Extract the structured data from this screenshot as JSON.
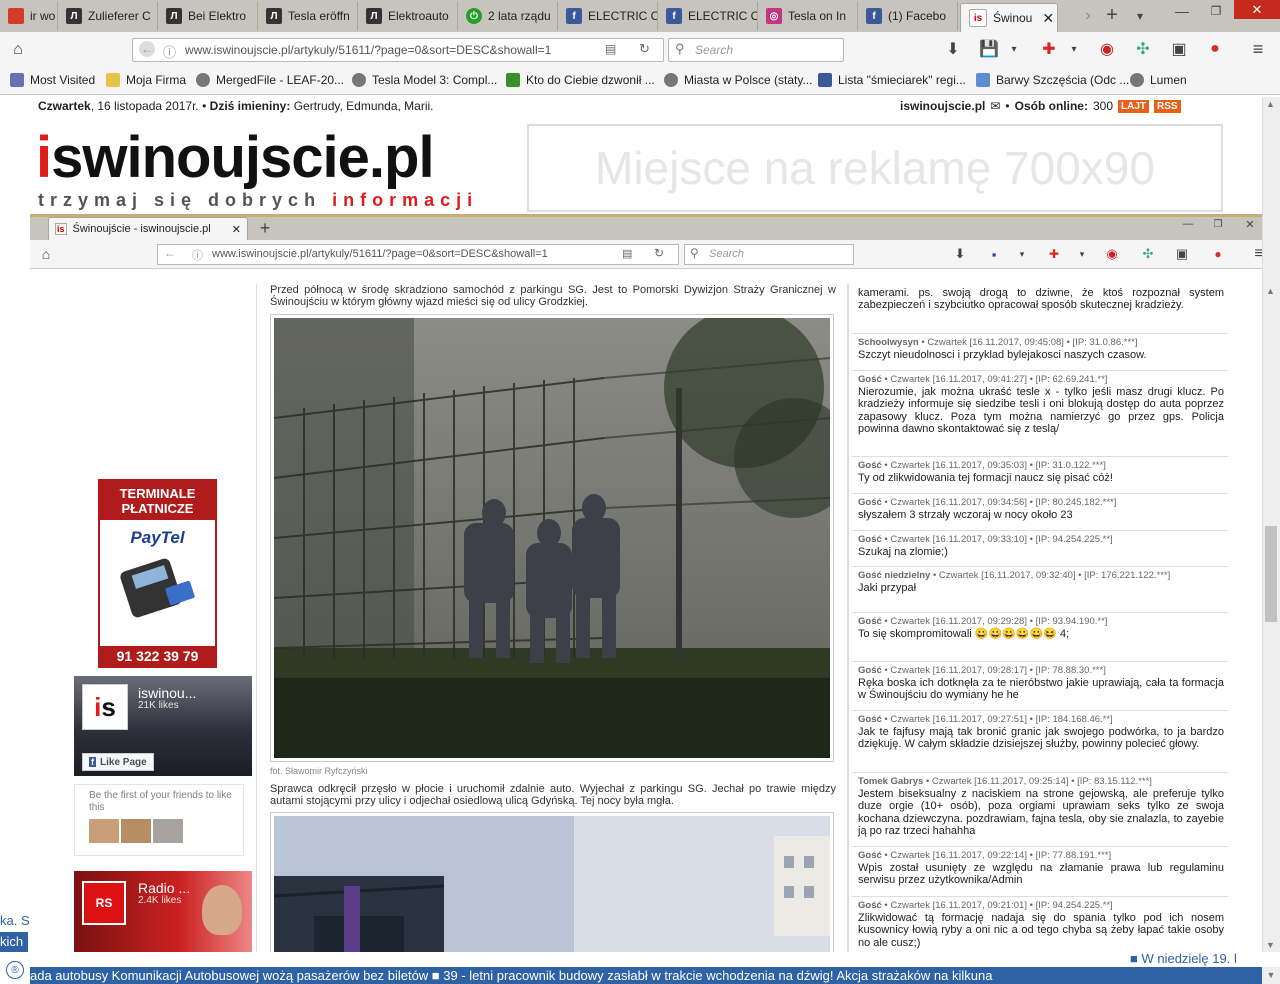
{
  "browser": {
    "tabs": [
      {
        "label": "ir wo",
        "color": "#d13d29"
      },
      {
        "label": "Zulieferer C",
        "color": "#333"
      },
      {
        "label": "Bei Elektro",
        "color": "#333"
      },
      {
        "label": "Tesla eröffn",
        "color": "#333"
      },
      {
        "label": "Elektroauto",
        "color": "#333"
      },
      {
        "label": "2 lata rządu",
        "color": "#24a02a"
      },
      {
        "label": "ELECTRIC C",
        "color": "#3b5998"
      },
      {
        "label": "ELECTRIC C",
        "color": "#3b5998"
      },
      {
        "label": "Tesla on In",
        "color": "#c13584"
      },
      {
        "label": "(1) Facebo",
        "color": "#3b5998"
      },
      {
        "label": "Świnou",
        "color": "#d00",
        "active": true
      }
    ],
    "url": "www.iswinoujscie.pl/artykuly/51611/?page=0&sort=DESC&showall=1",
    "search_placeholder": "Search",
    "bookmarks": [
      {
        "label": "Most Visited",
        "color": "#6a6fb3"
      },
      {
        "label": "Moja Firma",
        "color": "#e8c34a"
      },
      {
        "label": "MergedFile - LEAF-20...",
        "color": "#777"
      },
      {
        "label": "Tesla Model 3: Compl...",
        "color": "#777"
      },
      {
        "label": "Kto do Ciebie dzwonił ...",
        "color": "#3a8f2a"
      },
      {
        "label": "Miasta w Polsce (staty...",
        "color": "#777"
      },
      {
        "label": "Lista \"śmieciarek\" regi...",
        "color": "#3b5998"
      },
      {
        "label": "Barwy Szczęścia (Odc ...",
        "color": "#5a8ed1"
      },
      {
        "label": "Lumen",
        "color": "#777"
      }
    ],
    "inner_tab": "Świnoujście - iswinoujscie.pl"
  },
  "header": {
    "day": "Czwartek",
    "date": ", 16 listopada 2017r. •",
    "names_label": "Dziś imieniny:",
    "names": "Gertrudy, Edmunda, Marii.",
    "site": "iswinoujscie.pl",
    "online_label": "Osób online:",
    "online_count": "300",
    "lajt": "LAJT",
    "rss": "RSS",
    "logo_i": "i",
    "logo_rest": "swinoujscie.pl",
    "tagline_a": "trzymaj się dobrych",
    "tagline_b": "informacji",
    "ad_text": "Miejsce na reklamę 700x90"
  },
  "sidebar": {
    "terminal_title_1": "TERMINALE",
    "terminal_title_2": "PŁATNICZE",
    "paytel": "PayTel",
    "phone": "91 322 39 79",
    "fb1_name": "iswinou...",
    "fb1_likes": "21K likes",
    "fb_like_page": "Like Page",
    "fb_friends": "Be the first of your friends to like this",
    "fb2_name": "Radio ...",
    "fb2_likes": "2.4K likes",
    "edge_text_1": "ka. S",
    "edge_text_2": "kich"
  },
  "article": {
    "intro": "Przed północą w środę skradziono samochód z parkingu SG. Jest to Pomorski Dywizjon Straży Granicznej w Świnoujściu w którym główny wjazd mieści się od ulicy Grodzkiej.",
    "photo_credit": "fot. Sławomir Ryfczyński",
    "para2": "Sprawca odkręcił przęsło w płocie i uruchomił zdalnie auto. Wyjechał z parkingu SG. Jechał po trawie między autami stojącymi przy ulicy i odjechał osiedlową ulicą Gdyńską. Tej nocy była mgła."
  },
  "comments": [
    {
      "author": "",
      "meta": "",
      "text": "kamerami. ps. swoją drogą to dziwne, że ktoś rozpoznał system zabezpieczeń i szybciutko opracował sposób skutecznej kradzieży."
    },
    {
      "author": "Schoolwysyn",
      "meta": "• Czwartek [16.11.2017, 09:45:08] • [IP: 31.0.86.***]",
      "text": "Szczyt nieudolnosci i przyklad bylejakosci naszych czasow."
    },
    {
      "author": "Gość",
      "meta": "• Czwartek [16.11.2017, 09:41:27] • [IP: 62.69.241.**]",
      "text": "Nierozumie, jak można ukraść tesle x - tylko jeśli masz drugi klucz. Po kradzieży informuje się siedzibe tesli i oni blokują dostęp do auta poprzez zapasowy klucz. Poza tym można namierzyć go przez gps. Policja powinna dawno skontaktować się z teslą/"
    },
    {
      "author": "Gość",
      "meta": "• Czwartek [16.11.2017, 09:35:03] • [IP: 31.0.122.***]",
      "text": "Ty od zlikwidowania tej formacji naucz się pisać cóż!"
    },
    {
      "author": "Gość",
      "meta": "• Czwartek [16.11.2017, 09:34:56] • [IP: 80.245.182.***]",
      "text": "słyszałem 3 strzały wczoraj w nocy około 23"
    },
    {
      "author": "Gość",
      "meta": "• Czwartek [16.11.2017, 09:33:10] • [IP: 94.254.225.**]",
      "text": "Szukaj na zlomie;)"
    },
    {
      "author": "Gość niedzielny",
      "meta": "• Czwartek [16.11.2017, 09:32:40] • [IP: 176.221.122.***]",
      "text": "Jaki przypał"
    },
    {
      "author": "Gość",
      "meta": "• Czwartek [16.11.2017, 09:29:28] • [IP: 93.94.190.**]",
      "text": "To się skompromitowali 😀😀😀😀😀😆 4;"
    },
    {
      "author": "Gość",
      "meta": "• Czwartek [16.11.2017, 09:28:17] • [IP: 78.88.30.***]",
      "text": "Ręka boska ich dotknęła za te nieróbstwo jakie uprawiają, cała ta formacja w Świnoujściu do wymiany he he"
    },
    {
      "author": "Gość",
      "meta": "• Czwartek [16.11.2017, 09:27:51] • [IP: 184.168.46.**]",
      "text": "Jak te fajfusy mają tak bronić granic jak swojego podwórka, to ja bardzo dziękuję. W całym składzie dzisiejszej służby, powinny polecieć głowy."
    },
    {
      "author": "Tomek Gabrys",
      "meta": "• Czwartek [16.11.2017, 09:25:14] • [IP: 83.15.112.***]",
      "text": "Jestem biseksualny z naciskiem na strone gejowską, ale preferuje tylko duze orgie (10+ osób), poza orgiami uprawiam seks tylko ze swoja kochana dziewczyna. pozdrawiam, fajna tesla, oby sie znalazla, to zayebie ją po raz trzeci hahahha"
    },
    {
      "author": "Gość",
      "meta": "• Czwartek [16.11.2017, 09:22:14] • [IP: 77.88.191.***]",
      "text": "Wpis został usunięty ze względu na złamanie prawa lub regulaminu serwisu przez użytkownika/Admin"
    },
    {
      "author": "Gość",
      "meta": "• Czwartek [16.11.2017, 09:21:01] • [IP: 94.254.225.**]",
      "text": "Zlikwidować tą formację nadaja się do spania tylko pod ich nosem kusownicy łowią ryby a oni nic a od tego chyba są żeby łapać takie osoby no ale cusz;)"
    }
  ],
  "next_link": "■ W niedzielę 19. l",
  "ticker": "ada autobusy Komunikacji Autobusowej wożą pasażerów bez biletów ■ 39 - letni pracownik budowy zasłabł w trakcie wchodzenia na dźwig! Akcja strażaków na kilkuna"
}
